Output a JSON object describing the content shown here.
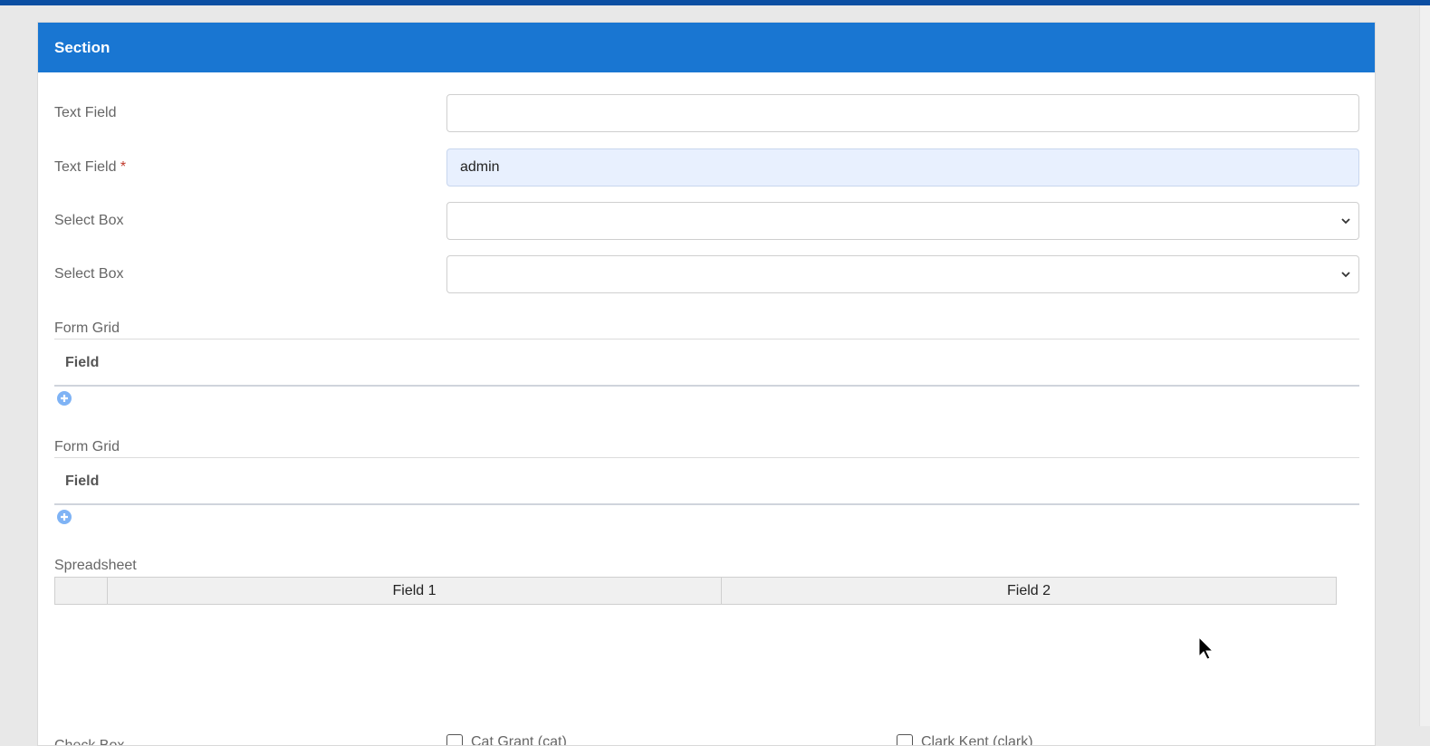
{
  "section": {
    "title": "Section"
  },
  "fields": {
    "text_field_1": {
      "label": "Text Field",
      "value": ""
    },
    "text_field_2": {
      "label": "Text Field",
      "required_mark": "*",
      "value": "admin"
    },
    "select_box_1": {
      "label": "Select Box",
      "value": ""
    },
    "select_box_2": {
      "label": "Select Box",
      "value": ""
    }
  },
  "form_grids": [
    {
      "title": "Form Grid",
      "column": "Field"
    },
    {
      "title": "Form Grid",
      "column": "Field"
    }
  ],
  "spreadsheet": {
    "title": "Spreadsheet",
    "columns": [
      "Field 1",
      "Field 2"
    ]
  },
  "checkbox": {
    "label": "Check Box",
    "options": [
      "Cat Grant (cat)",
      "Clark Kent (clark)"
    ]
  },
  "icons": {
    "add": "plus-circle-icon",
    "select": "chevron-down-icon",
    "cursor": "mouse-pointer-icon"
  },
  "colors": {
    "header_bg": "#1976d2",
    "top_bar": "#0b4ea2",
    "filled_input_bg": "#e8f0fe",
    "add_icon": "#7fb3f5"
  }
}
